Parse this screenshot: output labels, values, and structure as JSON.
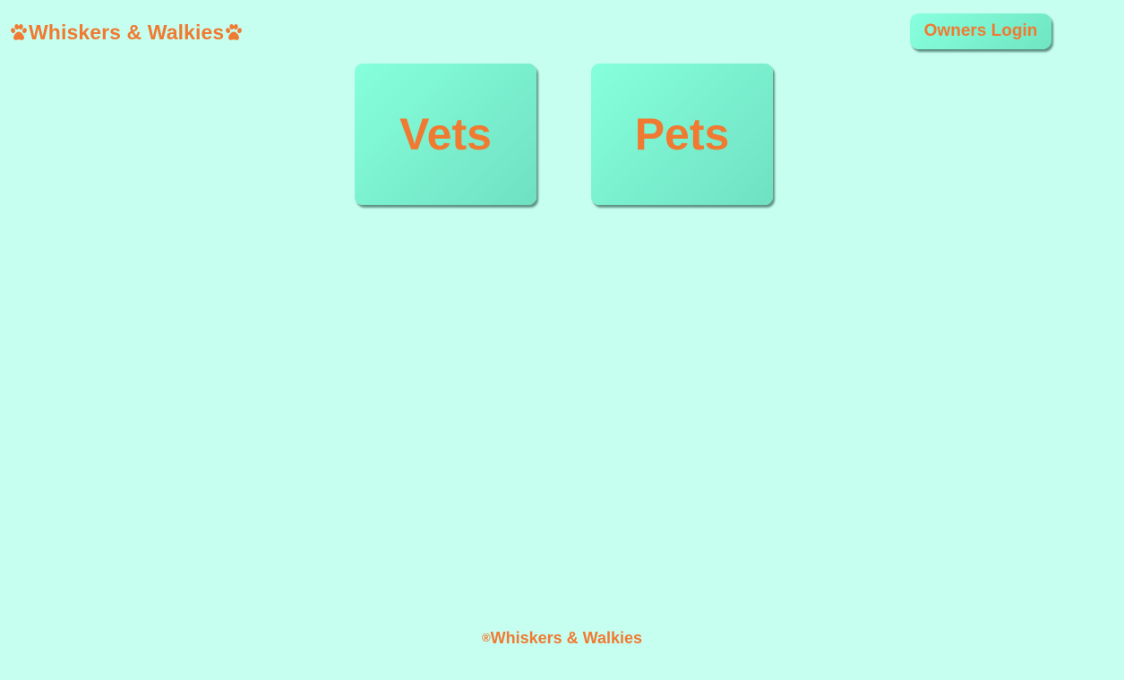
{
  "header": {
    "brand_name": "Whiskers & Walkies",
    "brand_icon": "paw-icon",
    "login_label": "Owners Login"
  },
  "tiles": [
    {
      "label": "Vets"
    },
    {
      "label": "Pets"
    }
  ],
  "footer": {
    "symbol": "®",
    "text": "Whiskers & Walkies"
  },
  "colors": {
    "background": "#c6fff0",
    "accent_text": "#f07a32",
    "button_gradient_start": "#86ffdc",
    "button_gradient_end": "#6fe1c2"
  }
}
